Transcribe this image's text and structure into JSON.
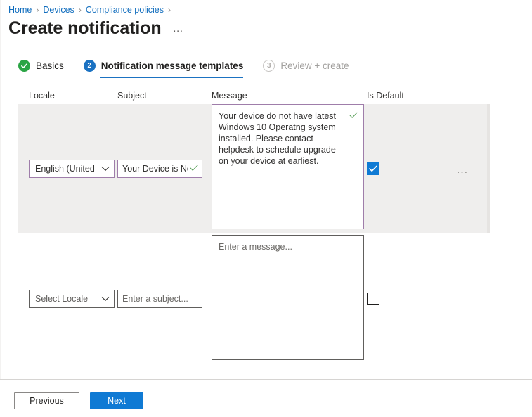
{
  "breadcrumb": {
    "items": [
      {
        "label": "Home"
      },
      {
        "label": "Devices"
      },
      {
        "label": "Compliance policies"
      }
    ],
    "separator": "›"
  },
  "header": {
    "title": "Create notification",
    "more_actions": "…"
  },
  "wizard": {
    "tabs": [
      {
        "label": "Basics",
        "state": "completed",
        "badge": "check-icon"
      },
      {
        "label": "Notification message templates",
        "state": "active",
        "badge": "2"
      },
      {
        "label": "Review + create",
        "state": "pending",
        "badge": "3"
      }
    ]
  },
  "table": {
    "columns": {
      "locale": "Locale",
      "subject": "Subject",
      "message": "Message",
      "is_default": "Is Default"
    },
    "rows": [
      {
        "locale_value": "English (United ...",
        "subject_value": "Your Device is No...",
        "message_value": "Your device do not have latest Windows 10 Operatng system installed. Please contact helpdesk to schedule upgrade on your device at earliest.",
        "is_default_checked": true,
        "row_menu": "…"
      },
      {
        "locale_placeholder": "Select Locale",
        "subject_placeholder": "Enter a subject...",
        "message_placeholder": "Enter a message...",
        "is_default_checked": false
      }
    ]
  },
  "footer": {
    "previous_label": "Previous",
    "next_label": "Next"
  },
  "colors": {
    "accent_blue": "#0f7ad4",
    "link_blue": "#0f6cbd",
    "success_green": "#2aa444",
    "field_purple": "#9f7daa",
    "row_highlight": "#efeeed"
  }
}
